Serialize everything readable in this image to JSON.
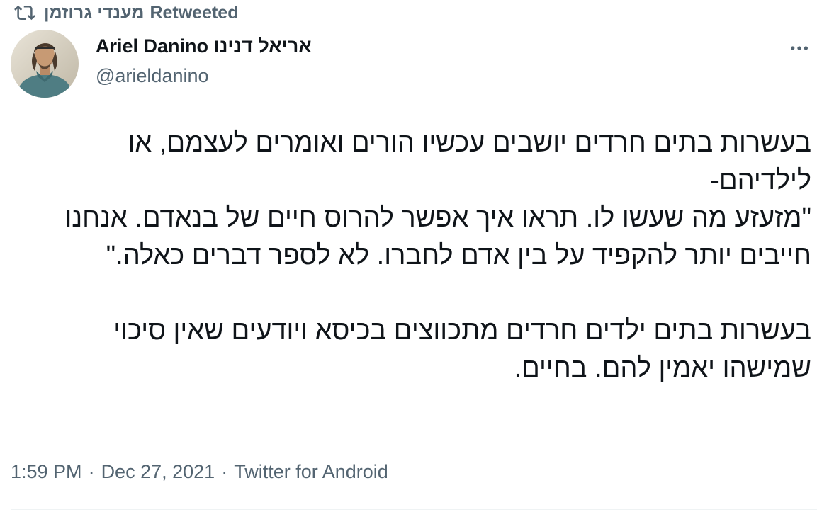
{
  "retweet": {
    "name": "מענדי גרוזמן",
    "label": "Retweeted",
    "icon": "retweet-icon"
  },
  "author": {
    "display_name_latin": "Ariel Danino",
    "display_name_hebrew": "אריאל דנינו",
    "handle": "@arieldanino",
    "avatar": "avatar-photo"
  },
  "more_button_icon": "more-dots-icon",
  "tweet": {
    "paragraphs": [
      "בעשרות בתים חרדים יושבים עכשיו הורים ואומרים לעצמם, או לילדיהם-",
      "\"מזעזע מה שעשו לו. תראו איך אפשר להרוס חיים של בנאדם. אנחנו חייבים יותר להקפיד על בין אדם לחברו. לא לספר דברים כאלה.\"",
      "בעשרות בתים ילדים חרדים מתכווצים בכיסא ויודעים שאין סיכוי שמישהו יאמין להם. בחיים."
    ]
  },
  "meta": {
    "time": "1:59 PM",
    "separator": "·",
    "date": "Dec 27, 2021",
    "source": "Twitter for Android"
  },
  "colors": {
    "text": "#0f1419",
    "secondary": "#536471",
    "divider": "#eff3f4"
  }
}
